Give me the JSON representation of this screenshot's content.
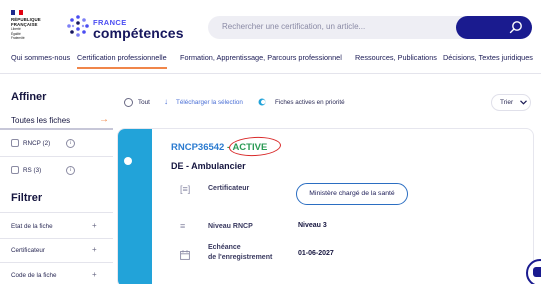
{
  "header": {
    "rf_lines": [
      "RÉPUBLIQUE",
      "FRANÇAISE"
    ],
    "rf_motto": [
      "Liberté",
      "Égalité",
      "Fraternité"
    ],
    "brand_small": "FRANCE",
    "brand_big": "compétences",
    "search_placeholder": "Rechercher une certification, un article...",
    "colors": {
      "brand_blue": "#1a1b8f",
      "accent": "#f0864a"
    }
  },
  "nav": {
    "items": [
      "Qui sommes-nous",
      "Certification professionnelle",
      "Formation, Apprentissage, Parcours professionnel",
      "Ressources, Publications",
      "Décisions, Textes juridiques"
    ],
    "active_index": 1
  },
  "sidebar": {
    "affiner_title": "Affiner",
    "all_tab": "Toutes les fiches",
    "checkboxes": [
      {
        "label": "RNCP (2)"
      },
      {
        "label": "RS (3)"
      }
    ],
    "filtrer_title": "Filtrer",
    "filters": [
      "Etat de la fiche",
      "Certificateur",
      "Code de la fiche"
    ]
  },
  "toolbar": {
    "tout": "Tout",
    "download": "Télécharger la sélection",
    "toggle_label": "Fiches actives en priorité",
    "sort": "Trier"
  },
  "card": {
    "code": "RNCP36542",
    "separator": " - ",
    "status": "ACTIVE",
    "name": "DE - Ambulancier",
    "certificateur_label": "Certificateur",
    "certificateur_value": "Ministère chargé de la santé",
    "niveau_label": "Niveau RNCP",
    "niveau_value": "Niveau 3",
    "echeance_label_1": "Echéance",
    "echeance_label_2": "de l'enregistrement",
    "echeance_value": "01-06-2027",
    "colors": {
      "strip": "#22a3d9",
      "status": "#2a9a54",
      "code": "#2b7bd0"
    }
  }
}
